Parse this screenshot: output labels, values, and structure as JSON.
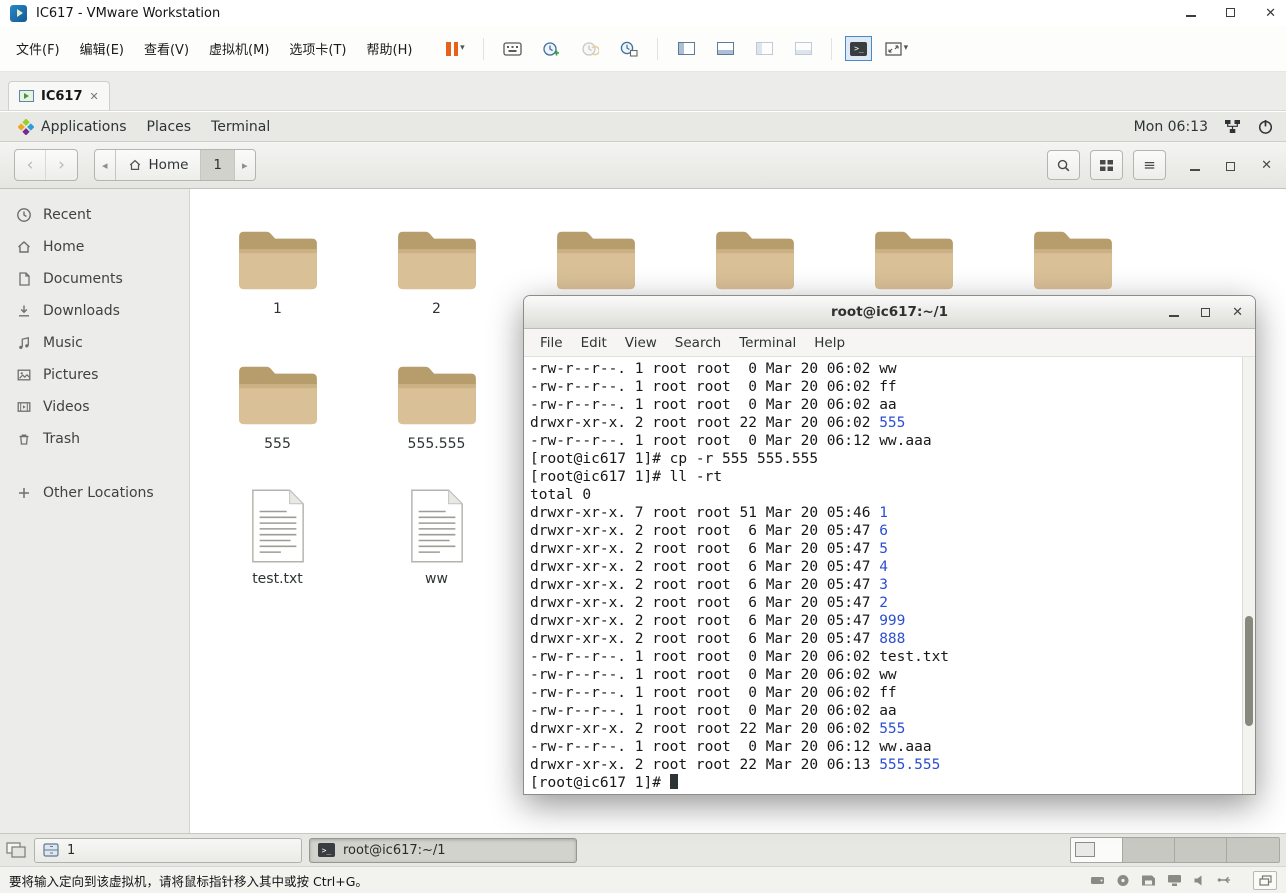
{
  "colors": {
    "dir": "#2b4fd0",
    "folder": "#d9c097",
    "folder-dark": "#b79c6c",
    "pause": "#e8611c",
    "accent": "#4c87c7"
  },
  "glyphs": {
    "close": "✕",
    "minimize": "–",
    "back": "‹",
    "forward": "›",
    "path_left": "◂",
    "path_right": "▸",
    "menu": "≡",
    "caret": "▾",
    "console": ">_",
    "plus": "+"
  },
  "vmware": {
    "title": "IC617 - VMware Workstation",
    "menus": [
      "文件(F)",
      "编辑(E)",
      "查看(V)",
      "虚拟机(M)",
      "选项卡(T)",
      "帮助(H)"
    ],
    "tab_label": "IC617",
    "status_hint": "要将输入定向到该虚拟机，请将鼠标指针移入其中或按 Ctrl+G。"
  },
  "topbar": {
    "menus": [
      "Applications",
      "Places",
      "Terminal"
    ],
    "clock": "Mon 06:13"
  },
  "files": {
    "path_home": "Home",
    "path_current": "1",
    "sidebar": [
      {
        "label": "Recent"
      },
      {
        "label": "Home"
      },
      {
        "label": "Documents"
      },
      {
        "label": "Downloads"
      },
      {
        "label": "Music"
      },
      {
        "label": "Pictures"
      },
      {
        "label": "Videos"
      },
      {
        "label": "Trash"
      }
    ],
    "other_locations": "Other Locations",
    "row1": [
      {
        "label": "1"
      },
      {
        "label": "2"
      },
      {
        "label": ""
      },
      {
        "label": ""
      },
      {
        "label": ""
      },
      {
        "label": ""
      }
    ],
    "row2": [
      {
        "label": "555"
      },
      {
        "label": "555.555"
      }
    ],
    "docs": [
      {
        "label": "test.txt"
      },
      {
        "label": "ww"
      }
    ]
  },
  "terminal": {
    "title": "root@ic617:~/1",
    "menus": [
      "File",
      "Edit",
      "View",
      "Search",
      "Terminal",
      "Help"
    ],
    "lines": [
      {
        "pre": "-rw-r--r--. 1 root root  0 Mar 20 06:02 ww",
        "hl": ""
      },
      {
        "pre": "-rw-r--r--. 1 root root  0 Mar 20 06:02 ff",
        "hl": ""
      },
      {
        "pre": "-rw-r--r--. 1 root root  0 Mar 20 06:02 aa",
        "hl": ""
      },
      {
        "pre": "drwxr-xr-x. 2 root root 22 Mar 20 06:02 ",
        "hl": "555"
      },
      {
        "pre": "-rw-r--r--. 1 root root  0 Mar 20 06:12 ww.aaa",
        "hl": ""
      },
      {
        "pre": "[root@ic617 1]# cp -r 555 555.555",
        "hl": ""
      },
      {
        "pre": "[root@ic617 1]# ll -rt",
        "hl": ""
      },
      {
        "pre": "total 0",
        "hl": ""
      },
      {
        "pre": "drwxr-xr-x. 7 root root 51 Mar 20 05:46 ",
        "hl": "1"
      },
      {
        "pre": "drwxr-xr-x. 2 root root  6 Mar 20 05:47 ",
        "hl": "6"
      },
      {
        "pre": "drwxr-xr-x. 2 root root  6 Mar 20 05:47 ",
        "hl": "5"
      },
      {
        "pre": "drwxr-xr-x. 2 root root  6 Mar 20 05:47 ",
        "hl": "4"
      },
      {
        "pre": "drwxr-xr-x. 2 root root  6 Mar 20 05:47 ",
        "hl": "3"
      },
      {
        "pre": "drwxr-xr-x. 2 root root  6 Mar 20 05:47 ",
        "hl": "2"
      },
      {
        "pre": "drwxr-xr-x. 2 root root  6 Mar 20 05:47 ",
        "hl": "999"
      },
      {
        "pre": "drwxr-xr-x. 2 root root  6 Mar 20 05:47 ",
        "hl": "888"
      },
      {
        "pre": "-rw-r--r--. 1 root root  0 Mar 20 06:02 test.txt",
        "hl": ""
      },
      {
        "pre": "-rw-r--r--. 1 root root  0 Mar 20 06:02 ww",
        "hl": ""
      },
      {
        "pre": "-rw-r--r--. 1 root root  0 Mar 20 06:02 ff",
        "hl": ""
      },
      {
        "pre": "-rw-r--r--. 1 root root  0 Mar 20 06:02 aa",
        "hl": ""
      },
      {
        "pre": "drwxr-xr-x. 2 root root 22 Mar 20 06:02 ",
        "hl": "555"
      },
      {
        "pre": "-rw-r--r--. 1 root root  0 Mar 20 06:12 ww.aaa",
        "hl": ""
      },
      {
        "pre": "drwxr-xr-x. 2 root root 22 Mar 20 06:13 ",
        "hl": "555.555"
      }
    ],
    "prompt": "[root@ic617 1]# "
  },
  "taskbar": {
    "buttons": [
      {
        "label": "1"
      },
      {
        "label": "root@ic617:~/1"
      }
    ]
  }
}
